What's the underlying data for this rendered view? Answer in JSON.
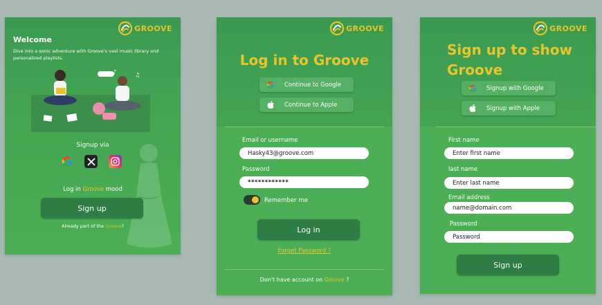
{
  "brand": {
    "name": "GROOVE",
    "accent": "#e8c52c",
    "panel_green": "#45a653",
    "button_green": "#2f7d44"
  },
  "welcome": {
    "title": "Welcome",
    "intro": "Dive into a sonic adventure with Groove's vast music library and personalized playlists.",
    "illustration_icon": "people-listening-music-illustration",
    "signup_via": "Signup via",
    "social_icons": [
      "google-icon",
      "x-icon",
      "instagram-icon"
    ],
    "mood_prefix": "Log in",
    "mood_brand": "Groove",
    "mood_suffix": "mood",
    "signup_button": "Sign up",
    "already_prefix": "Already part of the",
    "already_brand": "Groove",
    "already_suffix": "?"
  },
  "login": {
    "title": "Log in to Groove",
    "google_button": "Continue to Google",
    "apple_button": "Continue to Apple",
    "email_label": "Email or username",
    "email_value": "Hasky43@groove.com",
    "password_label": "Password",
    "password_value": "************",
    "remember_label": "Remember me",
    "remember_on": true,
    "login_button": "Log in",
    "forgot_link": "Forget Password ?",
    "no_account_prefix": "Don't have account on",
    "no_account_brand": "Groove",
    "no_account_suffix": "?"
  },
  "signup": {
    "title": "Sign up to show Groove",
    "google_button": "Signup with Google",
    "apple_button": "Signup with Apple",
    "first_name_label": "First name",
    "first_name_placeholder": "Enter first name",
    "last_name_label": "last name",
    "last_name_placeholder": "Enter last name",
    "email_label": "Email address",
    "email_placeholder": "name@domain.com",
    "password_label": "Password",
    "password_placeholder": "Password",
    "signup_button": "Sign up"
  }
}
